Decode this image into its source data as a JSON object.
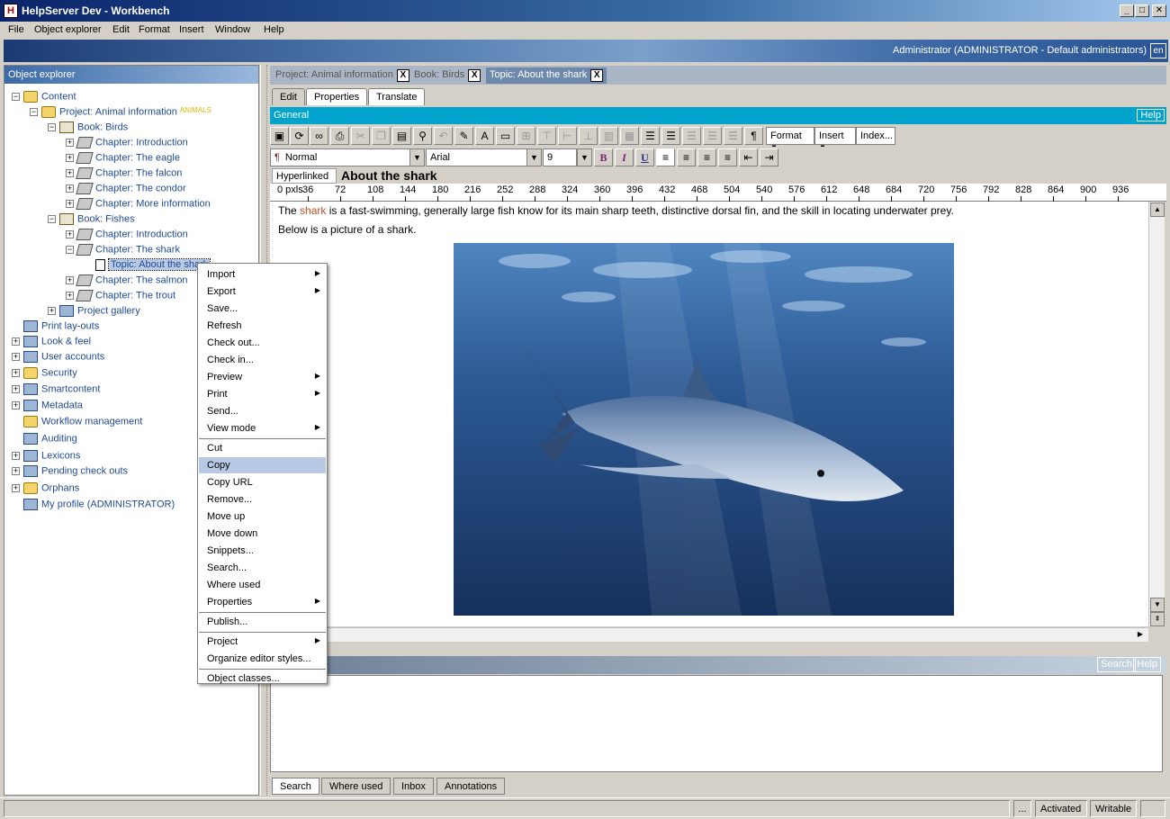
{
  "window": {
    "title": "HelpServer Dev - Workbench",
    "icon_glyph": "H"
  },
  "menubar": [
    "File",
    "Object explorer",
    "Edit",
    "Format",
    "Insert",
    "Window",
    "Help"
  ],
  "banner": {
    "user": "Administrator (ADMINISTRATOR - Default administrators)",
    "lang": "en"
  },
  "object_explorer": {
    "title": "Object explorer",
    "tree": [
      {
        "label": "Content",
        "exp": "−",
        "icon": "folder"
      },
      {
        "label": "Project: Animal information",
        "exp": "−",
        "icon": "folder",
        "badge": "ANIMALS"
      },
      {
        "label": "Book: Birds",
        "exp": "−",
        "icon": "book"
      },
      {
        "label": "Chapter: Introduction",
        "exp": "+",
        "icon": "chapter"
      },
      {
        "label": "Chapter: The eagle",
        "exp": "+",
        "icon": "chapter"
      },
      {
        "label": "Chapter: The falcon",
        "exp": "+",
        "icon": "chapter"
      },
      {
        "label": "Chapter: The condor",
        "exp": "+",
        "icon": "chapter"
      },
      {
        "label": "Chapter: More information",
        "exp": "+",
        "icon": "chapter"
      },
      {
        "label": "Book: Fishes",
        "exp": "−",
        "icon": "book"
      },
      {
        "label": "Chapter: Introduction",
        "exp": "+",
        "icon": "chapter"
      },
      {
        "label": "Chapter: The shark",
        "exp": "−",
        "icon": "chapter"
      },
      {
        "label": "Topic: About the shark",
        "exp": "",
        "icon": "doc"
      },
      {
        "label": "Chapter: The salmon",
        "exp": "+",
        "icon": "chapter"
      },
      {
        "label": "Chapter: The trout",
        "exp": "+",
        "icon": "chapter"
      },
      {
        "label": "Project gallery",
        "exp": "+",
        "icon": "misc"
      },
      {
        "label": "Print lay-outs",
        "exp": "",
        "icon": "misc"
      },
      {
        "label": "Look & feel",
        "exp": "+",
        "icon": "misc"
      },
      {
        "label": "User accounts",
        "exp": "+",
        "icon": "misc"
      },
      {
        "label": "Security",
        "exp": "+",
        "icon": "folder"
      },
      {
        "label": "Smartcontent",
        "exp": "+",
        "icon": "misc"
      },
      {
        "label": "Metadata",
        "exp": "+",
        "icon": "misc"
      },
      {
        "label": "Workflow management",
        "exp": "",
        "icon": "folder"
      },
      {
        "label": "Auditing",
        "exp": "",
        "icon": "misc"
      },
      {
        "label": "Lexicons",
        "exp": "+",
        "icon": "misc"
      },
      {
        "label": "Pending check outs",
        "exp": "+",
        "icon": "misc"
      },
      {
        "label": "Orphans",
        "exp": "+",
        "icon": "folder"
      },
      {
        "label": "My profile (ADMINISTRATOR)",
        "exp": "",
        "icon": "misc"
      }
    ]
  },
  "doc_tabs": [
    {
      "label": "Project: Animal information",
      "close": "X"
    },
    {
      "label": "Book: Birds",
      "close": "X"
    },
    {
      "label": "Topic: About the shark",
      "close": "X"
    }
  ],
  "edit_tabs": [
    "Edit",
    "Properties",
    "Translate"
  ],
  "general_bar": {
    "label": "General",
    "help": "Help"
  },
  "toolbar": {
    "format_label": "Format",
    "insert_label": "Insert",
    "index_label": "Index...",
    "style_value": "Normal",
    "font_value": "Arial",
    "size_value": "9",
    "pilcrow": "¶",
    "bold": "B",
    "italic": "I",
    "underline": "U"
  },
  "editor": {
    "hyperlinked": "Hyperlinked",
    "heading": "About the shark",
    "ruler_unit": "0 pxls",
    "ruler_ticks": [
      "36",
      "72",
      "108",
      "144",
      "180",
      "216",
      "252",
      "288",
      "324",
      "360",
      "396",
      "432",
      "468",
      "504",
      "540",
      "576",
      "612",
      "648",
      "684",
      "720",
      "756",
      "792",
      "828",
      "864",
      "900",
      "936"
    ],
    "para1_before": "The ",
    "para1_link": "shark",
    "para1_after": " is a fast-swimming, generally large fish know for its main sharp teeth, distinctive dorsal fin, and the skill in locating underwater prey.",
    "para2": "Below is a picture of a shark."
  },
  "bottom_panel": {
    "search_btn": "Search",
    "help_btn": "Help",
    "tabs": [
      "Search",
      "Where used",
      "Inbox",
      "Annotations"
    ]
  },
  "statusbar": {
    "ellipsis": "...",
    "state": "Activated",
    "mode": "Writable"
  },
  "context_menu": {
    "groups": [
      [
        {
          "label": "Import",
          "sub": true
        },
        {
          "label": "Export",
          "sub": true
        },
        {
          "label": "Save...",
          "sub": false
        },
        {
          "label": "Refresh",
          "sub": false
        },
        {
          "label": "Check out...",
          "sub": false
        },
        {
          "label": "Check in...",
          "sub": false
        },
        {
          "label": "Preview",
          "sub": true
        },
        {
          "label": "Print",
          "sub": true
        },
        {
          "label": "Send...",
          "sub": false
        },
        {
          "label": "View mode",
          "sub": true
        }
      ],
      [
        {
          "label": "Cut",
          "sub": false
        },
        {
          "label": "Copy",
          "sub": false,
          "highlighted": true
        },
        {
          "label": "Copy URL",
          "sub": false
        },
        {
          "label": "Remove...",
          "sub": false
        },
        {
          "label": "Move up",
          "sub": false
        },
        {
          "label": "Move down",
          "sub": false
        },
        {
          "label": "Snippets...",
          "sub": false
        },
        {
          "label": "Search...",
          "sub": false
        },
        {
          "label": "Where used",
          "sub": false
        },
        {
          "label": "Properties",
          "sub": true
        }
      ],
      [
        {
          "label": "Publish...",
          "sub": false
        }
      ],
      [
        {
          "label": "Project",
          "sub": true
        },
        {
          "label": "Organize editor styles...",
          "sub": false
        }
      ],
      [
        {
          "label": "Object classes...",
          "sub": false
        }
      ]
    ]
  },
  "colors": {
    "accent": "#00a3cc",
    "title_bar": "#0a246a",
    "link": "#1f4a96",
    "shark_word": "#c0502a",
    "selection": "#b7c9e5"
  }
}
